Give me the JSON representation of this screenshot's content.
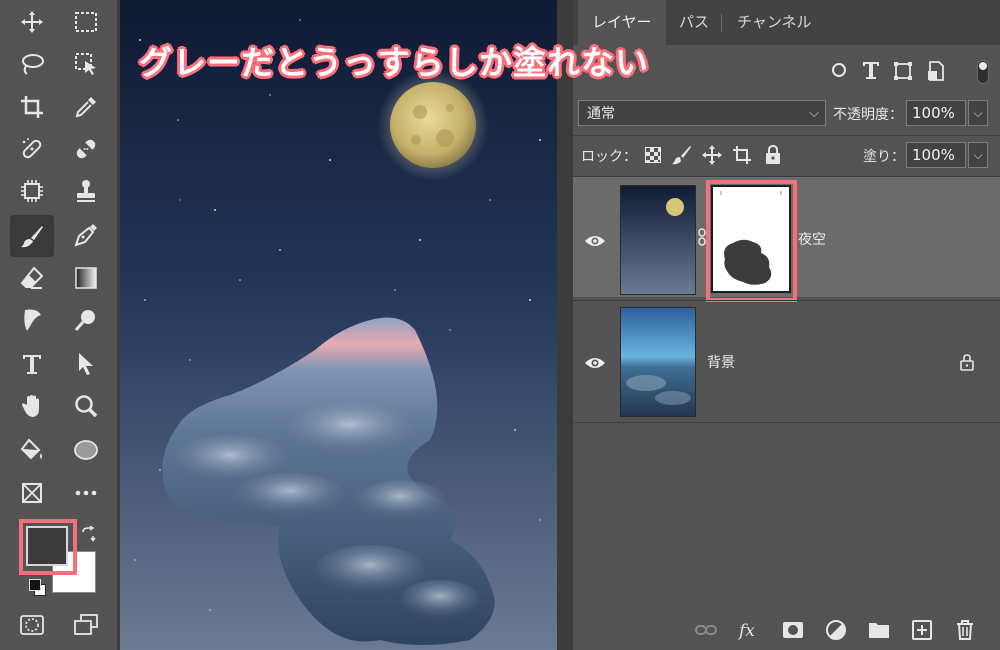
{
  "caption": "グレーだとうっすらしか塗れない",
  "tabs": [
    {
      "label": "レイヤー",
      "active": true
    },
    {
      "label": "パス",
      "active": false
    },
    {
      "label": "チャンネル",
      "active": false
    }
  ],
  "blend_mode": "通常",
  "opacity": {
    "label": "不透明度：",
    "value": "100%"
  },
  "lock": {
    "label": "ロック："
  },
  "fill": {
    "label": "塗り：",
    "value": "100%"
  },
  "layers": [
    {
      "name": "夜空",
      "visible": true,
      "has_mask": true,
      "locked": false
    },
    {
      "name": "背景",
      "visible": true,
      "has_mask": false,
      "locked": true
    }
  ],
  "colors": {
    "foreground": "#3b3b3b",
    "background": "#ffffff",
    "highlight": "#f4707a",
    "panel": "#535353"
  },
  "tools": [
    "move-icon",
    "marquee-icon",
    "lasso-icon",
    "object-select-icon",
    "crop-icon",
    "eyedropper-icon",
    "healing-icon",
    "bandage-icon",
    "chip-icon",
    "stamp-icon",
    "brush-icon",
    "pen-icon",
    "eraser-icon",
    "gradient-icon",
    "smudge-icon",
    "zoom-pin-icon",
    "type-icon",
    "arrow-icon",
    "hand-icon",
    "zoom-icon",
    "paint-bucket-icon",
    "ellipse-icon",
    "frame-icon",
    "more-icon"
  ],
  "active_tool": "brush-icon"
}
